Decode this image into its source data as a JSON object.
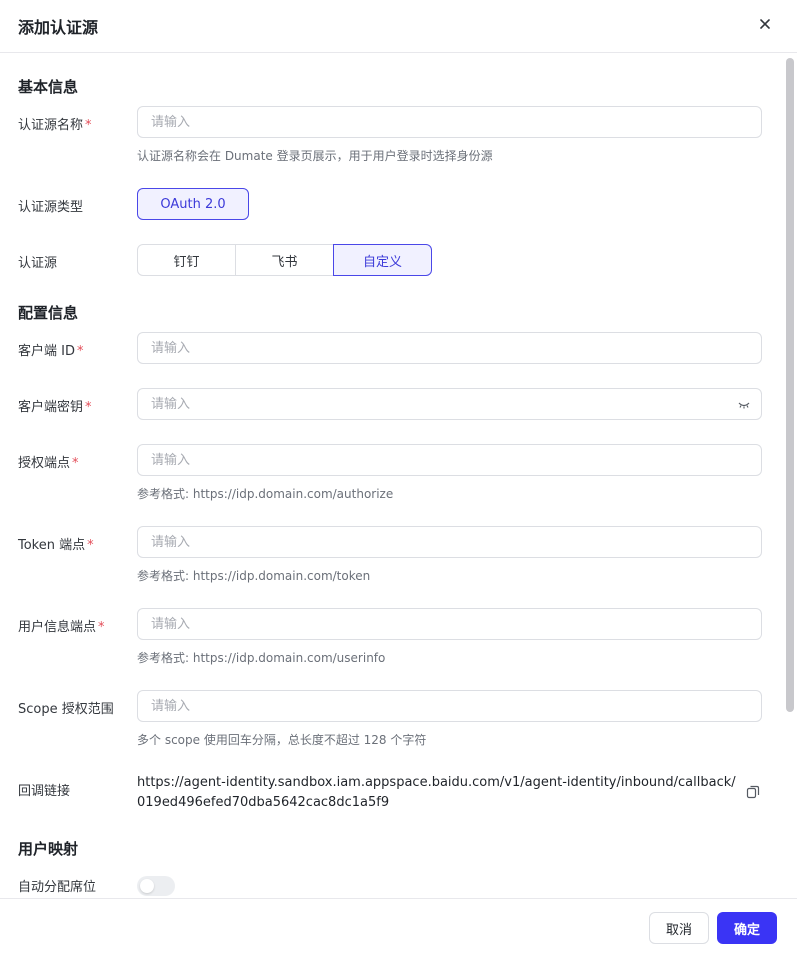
{
  "dialog": {
    "title": "添加认证源"
  },
  "basic": {
    "heading": "基本信息",
    "name_label": "认证源名称",
    "name_placeholder": "请输入",
    "name_hint": "认证源名称会在 Dumate 登录页展示，用于用户登录时选择身份源",
    "type_label": "认证源类型",
    "type_value": "OAuth 2.0",
    "source_label": "认证源",
    "source_options": [
      "钉钉",
      "飞书",
      "自定义"
    ],
    "source_selected": "自定义"
  },
  "config": {
    "heading": "配置信息",
    "client_id_label": "客户端 ID",
    "client_secret_label": "客户端密钥",
    "auth_endpoint_label": "授权端点",
    "auth_endpoint_hint": "参考格式: https://idp.domain.com/authorize",
    "token_endpoint_label": "Token 端点",
    "token_endpoint_hint": "参考格式: https://idp.domain.com/token",
    "userinfo_endpoint_label": "用户信息端点",
    "userinfo_endpoint_hint": "参考格式: https://idp.domain.com/userinfo",
    "scope_label": "Scope 授权范围",
    "scope_hint": "多个 scope 使用回车分隔，总长度不超过 128 个字符",
    "callback_label": "回调链接",
    "callback_url": "https://agent-identity.sandbox.iam.appspace.baidu.com/v1/agent-identity/inbound/callback/019ed496efed70dba5642cac8dc1a5f9",
    "placeholder": "请输入",
    "required_mark": "*"
  },
  "mapping": {
    "heading": "用户映射",
    "auto_seat_label": "自动分配席位",
    "auto_seat_enabled": false
  },
  "footer": {
    "cancel_label": "取消",
    "ok_label": "确定"
  },
  "colors": {
    "primary": "#3a34f5",
    "required": "#e34d59",
    "border": "#dcdee3"
  },
  "icons": {
    "close": "close-icon",
    "eye": "eye-closed-icon",
    "copy": "copy-icon"
  }
}
